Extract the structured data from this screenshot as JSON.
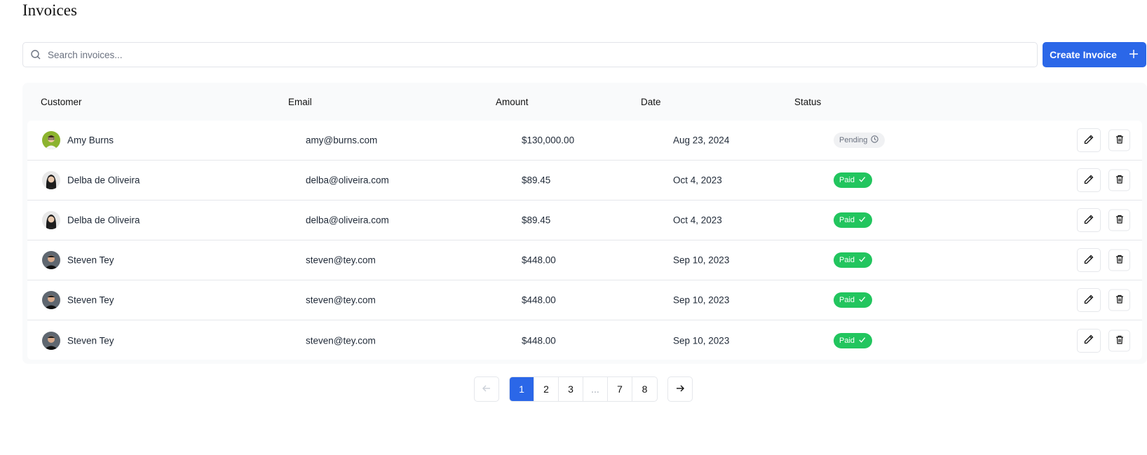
{
  "page": {
    "title": "Invoices"
  },
  "search": {
    "placeholder": "Search invoices...",
    "value": ""
  },
  "toolbar": {
    "create_label": "Create Invoice"
  },
  "table": {
    "columns": [
      "Customer",
      "Email",
      "Amount",
      "Date",
      "Status"
    ],
    "rows": [
      {
        "customer": "Amy Burns",
        "email": "amy@burns.com",
        "amount": "$130,000.00",
        "date": "Aug 23, 2024",
        "status": "Pending",
        "status_type": "pending",
        "avatar": "avatar-amy"
      },
      {
        "customer": "Delba de Oliveira",
        "email": "delba@oliveira.com",
        "amount": "$89.45",
        "date": "Oct 4, 2023",
        "status": "Paid",
        "status_type": "paid",
        "avatar": "avatar-delba"
      },
      {
        "customer": "Delba de Oliveira",
        "email": "delba@oliveira.com",
        "amount": "$89.45",
        "date": "Oct 4, 2023",
        "status": "Paid",
        "status_type": "paid",
        "avatar": "avatar-delba"
      },
      {
        "customer": "Steven Tey",
        "email": "steven@tey.com",
        "amount": "$448.00",
        "date": "Sep 10, 2023",
        "status": "Paid",
        "status_type": "paid",
        "avatar": "avatar-steven"
      },
      {
        "customer": "Steven Tey",
        "email": "steven@tey.com",
        "amount": "$448.00",
        "date": "Sep 10, 2023",
        "status": "Paid",
        "status_type": "paid",
        "avatar": "avatar-steven"
      },
      {
        "customer": "Steven Tey",
        "email": "steven@tey.com",
        "amount": "$448.00",
        "date": "Sep 10, 2023",
        "status": "Paid",
        "status_type": "paid",
        "avatar": "avatar-steven"
      }
    ]
  },
  "pagination": {
    "pages": [
      "1",
      "2",
      "3",
      "...",
      "7",
      "8"
    ],
    "current": "1"
  },
  "colors": {
    "accent": "#2b67e8",
    "paid": "#22c55e",
    "pending_bg": "#f0f1f3"
  },
  "icons": {
    "search": "search-icon",
    "create": "plus-icon",
    "edit": "pencil-icon",
    "delete": "trash-icon",
    "prev": "arrow-left-icon",
    "next": "arrow-right-icon",
    "pending": "clock-icon",
    "paid": "check-icon"
  }
}
